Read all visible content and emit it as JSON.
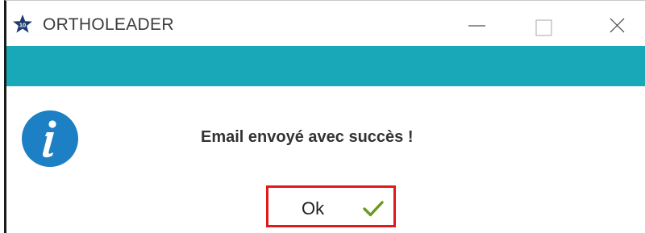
{
  "window": {
    "title": "ORTHOLEADER",
    "app_icon": "star-badge-icon",
    "controls": {
      "minimize": "minimize-icon",
      "maximize": "maximize-icon",
      "close": "close-icon"
    }
  },
  "theme": {
    "accent": "#19a8b7",
    "info_icon_color": "#1d7fc4",
    "highlight_border": "#e01a1a",
    "check_color": "#6a9a1f"
  },
  "dialog": {
    "icon": "info-icon",
    "message": "Email envoyé avec succès !",
    "ok_label": "Ok",
    "ok_icon": "checkmark-icon"
  }
}
